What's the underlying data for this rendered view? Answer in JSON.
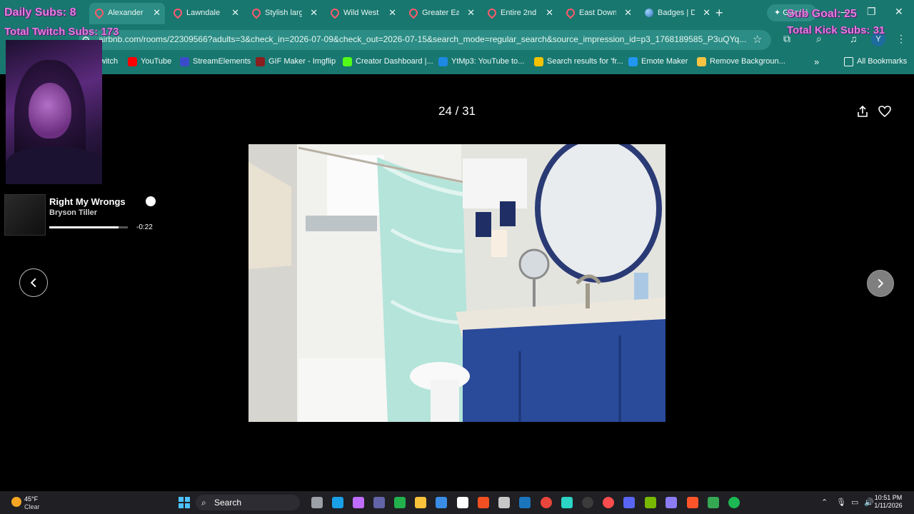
{
  "browser": {
    "tabs": [
      {
        "title": "Alexander",
        "icon": "airbnb-icon",
        "active": true
      },
      {
        "title": "Lawndale",
        "icon": "airbnb-icon"
      },
      {
        "title": "Stylish larg",
        "icon": "airbnb-icon"
      },
      {
        "title": "Wild West",
        "icon": "airbnb-icon"
      },
      {
        "title": "Greater Ea",
        "icon": "airbnb-icon"
      },
      {
        "title": "Entire 2nd",
        "icon": "airbnb-icon"
      },
      {
        "title": "East Down",
        "icon": "airbnb-icon"
      },
      {
        "title": "Badges | D",
        "icon": "globe-icon"
      }
    ],
    "new_tab": "+",
    "gemini": "Gemini",
    "url": "airbnb.com/rooms/22309566?adults=3&check_in=2026-07-09&check_out=2026-07-15&search_mode=regular_search&source_impression_id=p3_1768189585_P3uQYq...",
    "profile_initial": "Y",
    "bookmarks": [
      {
        "label": "witch",
        "color": "#9146ff"
      },
      {
        "label": "YouTube",
        "color": "#ff0000"
      },
      {
        "label": "StreamElements",
        "color": "#3b4cca"
      },
      {
        "label": "GIF Maker - Imgflip",
        "color": "#8b1e1e"
      },
      {
        "label": "Creator Dashboard |...",
        "color": "#53fc18"
      },
      {
        "label": "YtMp3: YouTube to...",
        "color": "#1e88e5"
      },
      {
        "label": "Search results for 'fr...",
        "color": "#f2c200"
      },
      {
        "label": "Emote Maker",
        "color": "#2196f3"
      },
      {
        "label": "Remove Backgroun...",
        "color": "#f6c343"
      }
    ],
    "bookmarks_more": "»",
    "all_bookmarks": "All Bookmarks"
  },
  "stream_overlay": {
    "daily_subs": "Daily Subs: 8",
    "total_twitch": "Total Twitch Subs: 173",
    "sub_goal": "Sub Goal: 25",
    "total_kick": "Total Kick Subs: 31"
  },
  "now_playing": {
    "song": "Right My Wrongs",
    "artist": "Bryson Tiller",
    "remaining": "-0:22",
    "progress": 0.88
  },
  "gallery": {
    "counter": "24 / 31",
    "share_icon": "share-icon",
    "heart_icon": "heart-icon",
    "prev_icon": "chevron-left-icon",
    "next_icon": "chevron-right-icon"
  },
  "taskbar": {
    "temperature": "45°F",
    "condition": "Clear",
    "search": "Search",
    "time": "10:51 PM",
    "date": "1/11/2026"
  }
}
